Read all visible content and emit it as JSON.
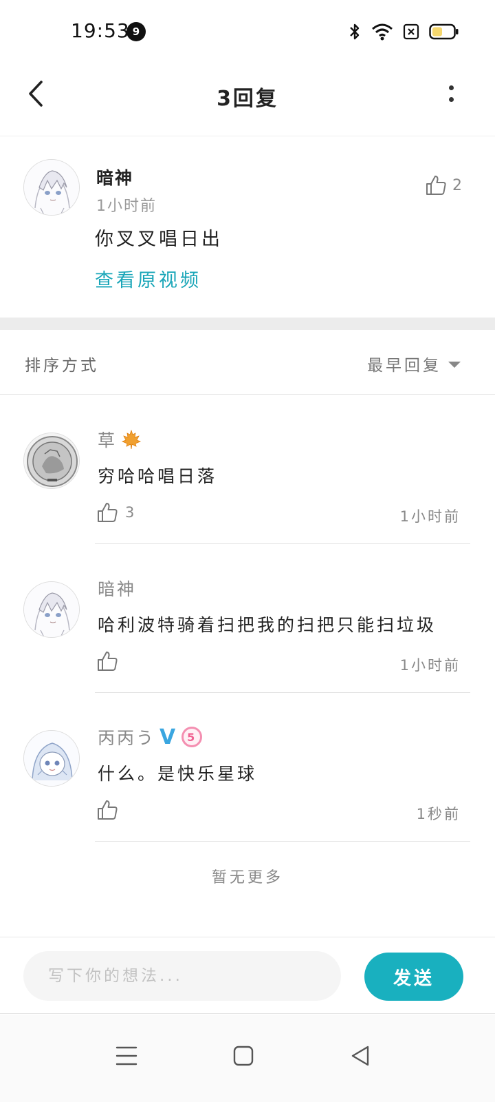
{
  "status_bar": {
    "time": "19:53",
    "notification_count": "9"
  },
  "header": {
    "title": "3回复"
  },
  "main_comment": {
    "author": "暗神",
    "time": "1小时前",
    "text": "你叉叉唱日出",
    "like_count": "2",
    "view_video_label": "查看原视频"
  },
  "sort": {
    "label": "排序方式",
    "selected": "最早回复"
  },
  "replies": [
    {
      "author": "草",
      "badge_icon": "maple-leaf-icon",
      "text": "穷哈哈唱日落",
      "like_count": "3",
      "time": "1小时前"
    },
    {
      "author": "暗神",
      "text": "哈利波特骑着扫把我的扫把只能扫垃圾",
      "like_count": "",
      "time": "1小时前"
    },
    {
      "author": "丙丙う",
      "vip_badge": "V",
      "level_badge": "5",
      "text": "什么。是快乐星球",
      "like_count": "",
      "time": "1秒前"
    }
  ],
  "no_more_text": "暂无更多",
  "input": {
    "placeholder": "写下你的想法...",
    "send_label": "发送"
  },
  "colors": {
    "accent": "#19b0bf",
    "link": "#1aa6b8"
  }
}
